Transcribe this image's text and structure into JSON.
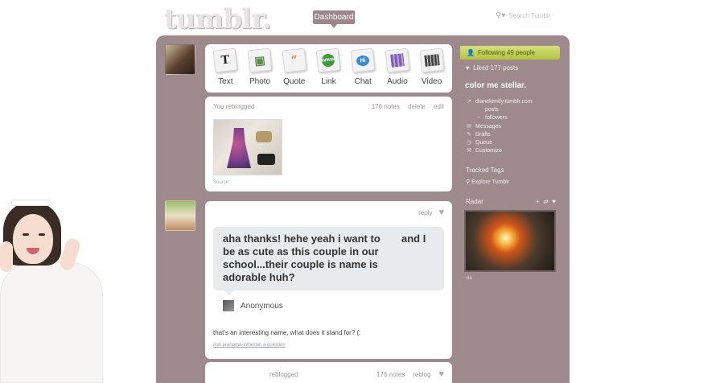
{
  "header": {
    "logo": "tumblr.",
    "dashboard_tab": "Dashboard",
    "search_placeholder": "Search Tumblr"
  },
  "post_types": [
    {
      "label": "Text",
      "icon": "text-icon",
      "glyph": "T"
    },
    {
      "label": "Photo",
      "icon": "photo-icon",
      "glyph": "▣"
    },
    {
      "label": "Quote",
      "icon": "quote-icon",
      "glyph": "“"
    },
    {
      "label": "Link",
      "icon": "link-icon",
      "glyph": "www"
    },
    {
      "label": "Chat",
      "icon": "chat-icon",
      "glyph": "Hi"
    },
    {
      "label": "Audio",
      "icon": "audio-icon",
      "glyph": ""
    },
    {
      "label": "Video",
      "icon": "video-icon",
      "glyph": ""
    }
  ],
  "posts": [
    {
      "header": "You reblogged",
      "notes": "176 notes",
      "delete": "delete",
      "edit": "edit",
      "source": "Source:"
    },
    {
      "reply": "reply",
      "question": "aha thanks! hehe yeah i want to be as cute as this couple in our school...their couple is name is adorable huh?",
      "question_tail": "and I",
      "asker": "Anonymous",
      "answer": "that's an interesting name, what does it stand for? (:",
      "ask_link": "Ask pranoma-intherain a question"
    },
    {
      "header": "reblogged",
      "notes": "176 notes",
      "reblog": "reblog"
    }
  ],
  "sidebar": {
    "following": "Following 49 people",
    "liked": "Liked 177 posts",
    "blog_title": "color me stellar.",
    "links": [
      {
        "icon": "external-link-icon",
        "glyph": "↗",
        "label": "dianekimify.tumblr.com",
        "indent": false
      },
      {
        "icon": "",
        "glyph": "",
        "label": "posts",
        "indent": true
      },
      {
        "icon": "",
        "glyph": "~",
        "label": "followers",
        "indent": true
      },
      {
        "icon": "mail-icon",
        "glyph": "✉",
        "label": "Messages",
        "indent": false
      },
      {
        "icon": "drafts-icon",
        "glyph": "✎",
        "label": "Drafts",
        "indent": false
      },
      {
        "icon": "queue-icon",
        "glyph": "◷",
        "label": "Queue",
        "indent": false
      },
      {
        "icon": "wrench-icon",
        "glyph": "⚒",
        "label": "Customize",
        "indent": false
      }
    ],
    "tracked_title": "Tracked Tags",
    "explore": "Explore Tumblr",
    "radar_title": "Radar",
    "radar_icons": [
      "+",
      "⇄",
      "♥"
    ],
    "via": "via"
  },
  "colors": {
    "panel": "#9e8a8d",
    "follow_bar": "#c5d15a",
    "dashboard_tab": "#9c8689"
  }
}
